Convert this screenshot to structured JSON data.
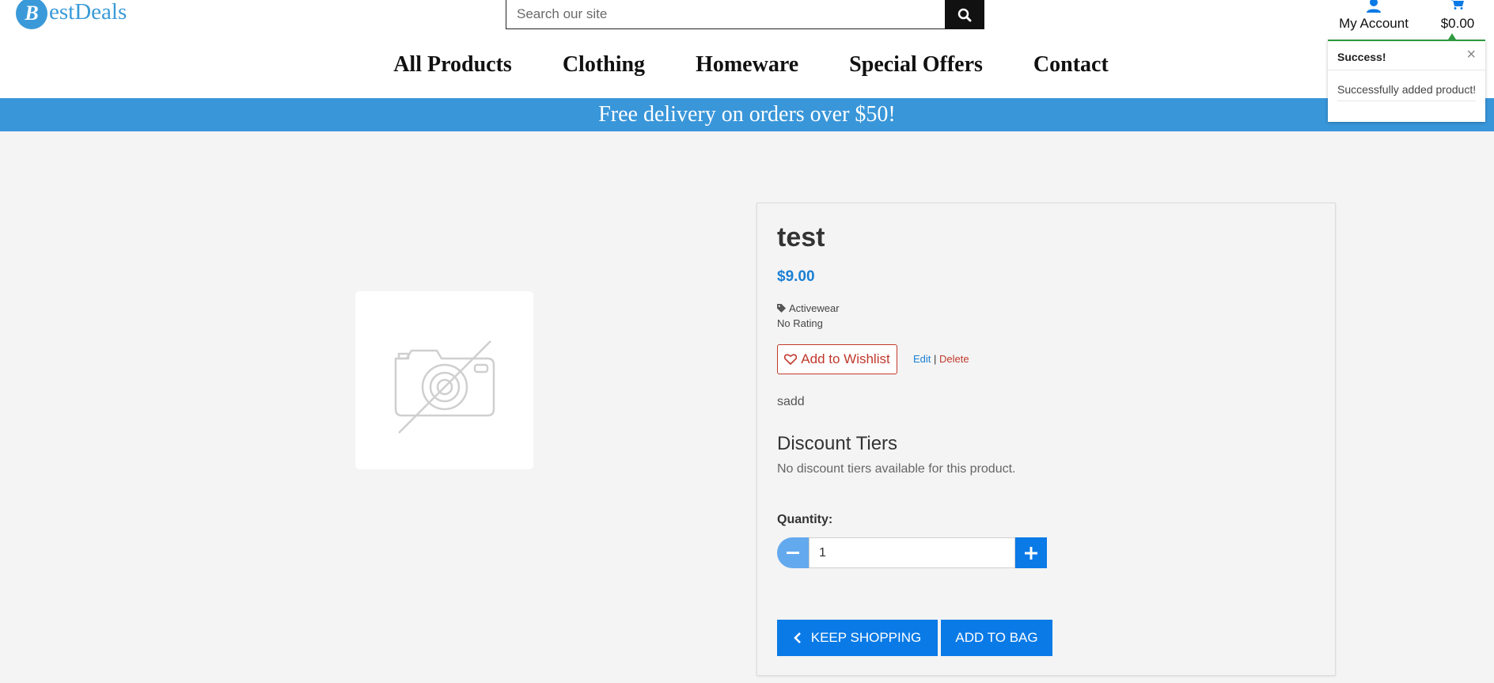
{
  "header": {
    "logo_letter": "B",
    "logo_text": "estDeals",
    "search": {
      "placeholder": "Search our site"
    },
    "account_label": "My Account",
    "cart_total": "$0.00",
    "nav": [
      "All Products",
      "Clothing",
      "Homeware",
      "Special Offers",
      "Contact"
    ]
  },
  "promo_banner": "Free delivery on orders over $50!",
  "toast": {
    "title": "Success!",
    "close": "×",
    "message": "Successfully added product!"
  },
  "product": {
    "image": "no-image-placeholder-icon",
    "title": "test",
    "price": "$9.00",
    "category": "Activewear",
    "rating": "No Rating",
    "wishlist_label": "Add to Wishlist",
    "edit_label": "Edit",
    "separator": "|",
    "delete_label": "Delete",
    "description": "sadd",
    "discount_heading": "Discount Tiers",
    "discount_text": "No discount tiers available for this product.",
    "quantity_label": "Quantity:",
    "quantity_value": "1",
    "keep_shopping_label": "KEEP SHOPPING",
    "add_to_bag_label": "ADD TO BAG"
  },
  "colors": {
    "brand_blue": "#3a9ad9",
    "button_blue": "#0a7ae6",
    "price_blue": "#1a7fd4",
    "danger_red": "#c0392b",
    "success_green": "#2f9a3f"
  }
}
